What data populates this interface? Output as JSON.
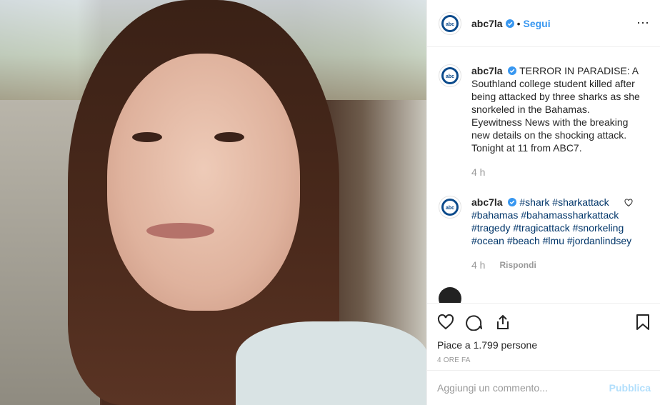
{
  "post": {
    "account": "abc7la",
    "follow_label": "Segui",
    "logo_text": "abc"
  },
  "comments": [
    {
      "user": "abc7la",
      "text": "TERROR IN PARADISE: A Southland college student killed after being attacked by three sharks as she snorkeled in the Bahamas. Eyewitness News with the breaking new details on the shocking attack. Tonight at 11 from ABC7.",
      "time": "4 h"
    },
    {
      "user": "abc7la",
      "text": "#shark #sharkattack #bahamas #bahamassharkattack #tragedy #tragicattack #snorkeling #ocean #beach #lmu #jordanlindsey",
      "time": "4 h",
      "reply_label": "Rispondi"
    }
  ],
  "actions": {
    "likes_text": "Piace a 1.799 persone",
    "post_time": "4 ORE FA",
    "comment_placeholder": "Aggiungi un commento...",
    "publish_label": "Pubblica"
  },
  "colors": {
    "link": "#3897f0",
    "hashtag": "#003569",
    "verified": "#3897f0"
  }
}
